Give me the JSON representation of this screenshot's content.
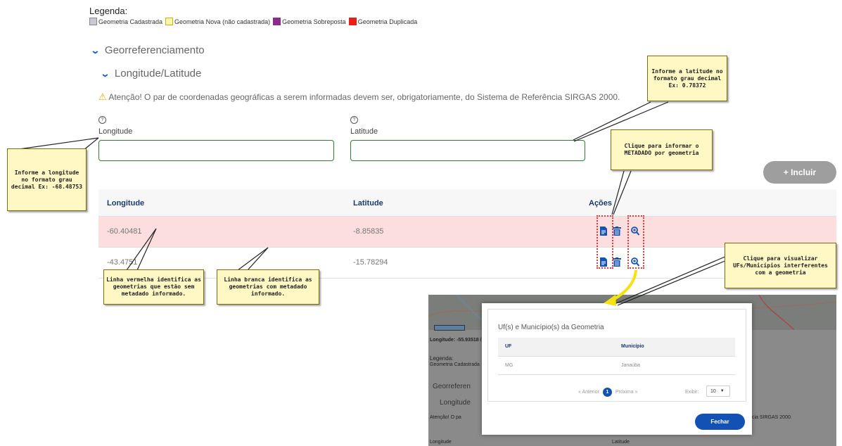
{
  "legend": {
    "title": "Legenda:",
    "items": [
      {
        "label": "Geometria Cadastrada",
        "color": "#c9c9d3"
      },
      {
        "label": "Geometria Nova (não cadastrada)",
        "color": "#fff5b0"
      },
      {
        "label": "Geometria Sobreposta",
        "color": "#8e2a8e"
      },
      {
        "label": "Geometria Duplicada",
        "color": "#ee1b1b"
      }
    ]
  },
  "sections": {
    "georef": "Georreferenciamento",
    "lonlat": "Longitude/Latitude"
  },
  "warning": "Atenção! O par de coordenadas geográficas a serem informadas devem ser, obrigatoriamente, do Sistema de Referência SIRGAS 2000.",
  "form": {
    "help_icon": "?",
    "longitude_label": "Longitude",
    "latitude_label": "Latitude",
    "longitude_value": "",
    "latitude_value": ""
  },
  "incluir_label": "+ Incluir",
  "table": {
    "headers": [
      "Longitude",
      "Latitude",
      "Ações"
    ],
    "rows": [
      {
        "longitude": "-60.40481",
        "latitude": "-8.85835",
        "status": "sem-metadado",
        "bg": "#fddede"
      },
      {
        "longitude": "-43.4751",
        "latitude": "-15.78294",
        "status": "com-metadado",
        "bg": "#ffffff"
      }
    ]
  },
  "annotations": {
    "latitude_note": "Informe a latitude no formato grau decimal Ex: 0.78372",
    "longitude_note": "Informe a longitude no formato grau decimal Ex: -68.48753",
    "metadado_note": "Clique para informar o METADADO por geometria",
    "visualizar_note": "Clique para visualizar UFs/Municípios interferentes com a geometria",
    "red_row_note": "Linha vermelha identifica as geometrias que estão sem metadado informado.",
    "white_row_note": "Linha branca identifica as geometrias com metadado informado."
  },
  "background_screen": {
    "coord_readout": "Longitude: -55.93518 /",
    "legend_title": "Legenda:",
    "legend_item": "Geometria Cadastrada",
    "georef": "Georreferen",
    "lonlat": "Longitude",
    "warn_start": "Atenção! O pa",
    "warn_end": "cia SIRGAS 2000.",
    "lon_label": "Longitude",
    "lat_label": "Latitude"
  },
  "modal": {
    "title": "Uf(s) e Município(s) da Geometria",
    "headers": [
      "UF",
      "Município"
    ],
    "rows": [
      {
        "uf": "MG",
        "municipio": "Janaúba"
      }
    ],
    "pagination": {
      "prev": "« Anterior",
      "current": "1",
      "next": "Próxima »"
    },
    "exibir_label": "Exibir:",
    "exibir_value": "10",
    "close_label": "Fechar"
  },
  "colors": {
    "brand_blue": "#1351b4",
    "input_border": "#2e7d32",
    "highlight_dash": "#e53935",
    "note_bg": "#fff8c4",
    "arrow_yellow": "#f5e20f"
  }
}
